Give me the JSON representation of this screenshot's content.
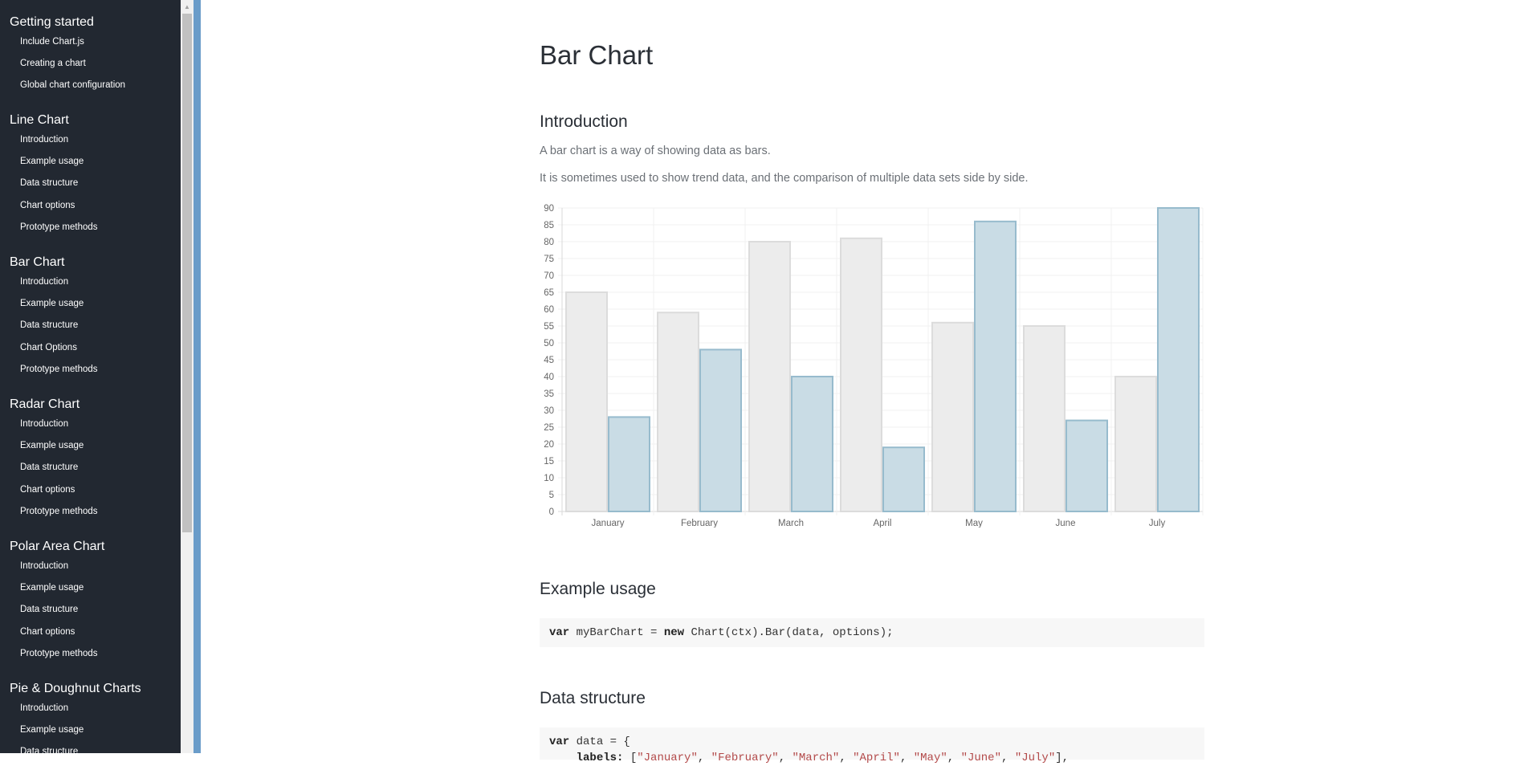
{
  "sidebar": {
    "sections": [
      {
        "title": "Getting started",
        "items": [
          "Include Chart.js",
          "Creating a chart",
          "Global chart configuration"
        ]
      },
      {
        "title": "Line Chart",
        "items": [
          "Introduction",
          "Example usage",
          "Data structure",
          "Chart options",
          "Prototype methods"
        ]
      },
      {
        "title": "Bar Chart",
        "items": [
          "Introduction",
          "Example usage",
          "Data structure",
          "Chart Options",
          "Prototype methods"
        ]
      },
      {
        "title": "Radar Chart",
        "items": [
          "Introduction",
          "Example usage",
          "Data structure",
          "Chart options",
          "Prototype methods"
        ]
      },
      {
        "title": "Polar Area Chart",
        "items": [
          "Introduction",
          "Example usage",
          "Data structure",
          "Chart options",
          "Prototype methods"
        ]
      },
      {
        "title": "Pie & Doughnut Charts",
        "items": [
          "Introduction",
          "Example usage",
          "Data structure"
        ]
      }
    ]
  },
  "main": {
    "title": "Bar Chart",
    "intro_heading": "Introduction",
    "intro_p1": "A bar chart is a way of showing data as bars.",
    "intro_p2": "It is sometimes used to show trend data, and the comparison of multiple data sets side by side.",
    "example_heading": "Example usage",
    "example_code": {
      "kw1": "var",
      "t1": " myBarChart = ",
      "kw2": "new",
      "t2": " Chart(ctx).Bar(data, options);"
    },
    "data_heading": "Data structure",
    "data_code": {
      "line1_kw": "var",
      "line1_rest": " data = {",
      "line2_indent": "    ",
      "line2_key": "labels:",
      "line2_open": " [",
      "labels": [
        "\"January\"",
        "\"February\"",
        "\"March\"",
        "\"April\"",
        "\"May\"",
        "\"June\"",
        "\"July\""
      ],
      "line2_close": "],"
    }
  },
  "colors": {
    "sidebar_bg": "#222831",
    "accent_strip": "#6a9cc9",
    "series1_fill": "#ececec",
    "series1_stroke": "#dcdcdc",
    "series2_fill": "#c9dce5",
    "series2_stroke": "#97bbcd"
  },
  "chart_data": {
    "type": "bar",
    "categories": [
      "January",
      "February",
      "March",
      "April",
      "May",
      "June",
      "July"
    ],
    "series": [
      {
        "values": [
          65,
          59,
          80,
          81,
          56,
          55,
          40
        ],
        "fill": "#ececec",
        "stroke": "#dcdcdc"
      },
      {
        "values": [
          28,
          48,
          40,
          19,
          86,
          27,
          90
        ],
        "fill": "#c9dce5",
        "stroke": "#97bbcd"
      }
    ],
    "ylim": [
      0,
      90
    ],
    "yticks": [
      0,
      5,
      10,
      15,
      20,
      25,
      30,
      35,
      40,
      45,
      50,
      55,
      60,
      65,
      70,
      75,
      80,
      85,
      90
    ],
    "grid": true,
    "title": "",
    "xlabel": "",
    "ylabel": ""
  }
}
